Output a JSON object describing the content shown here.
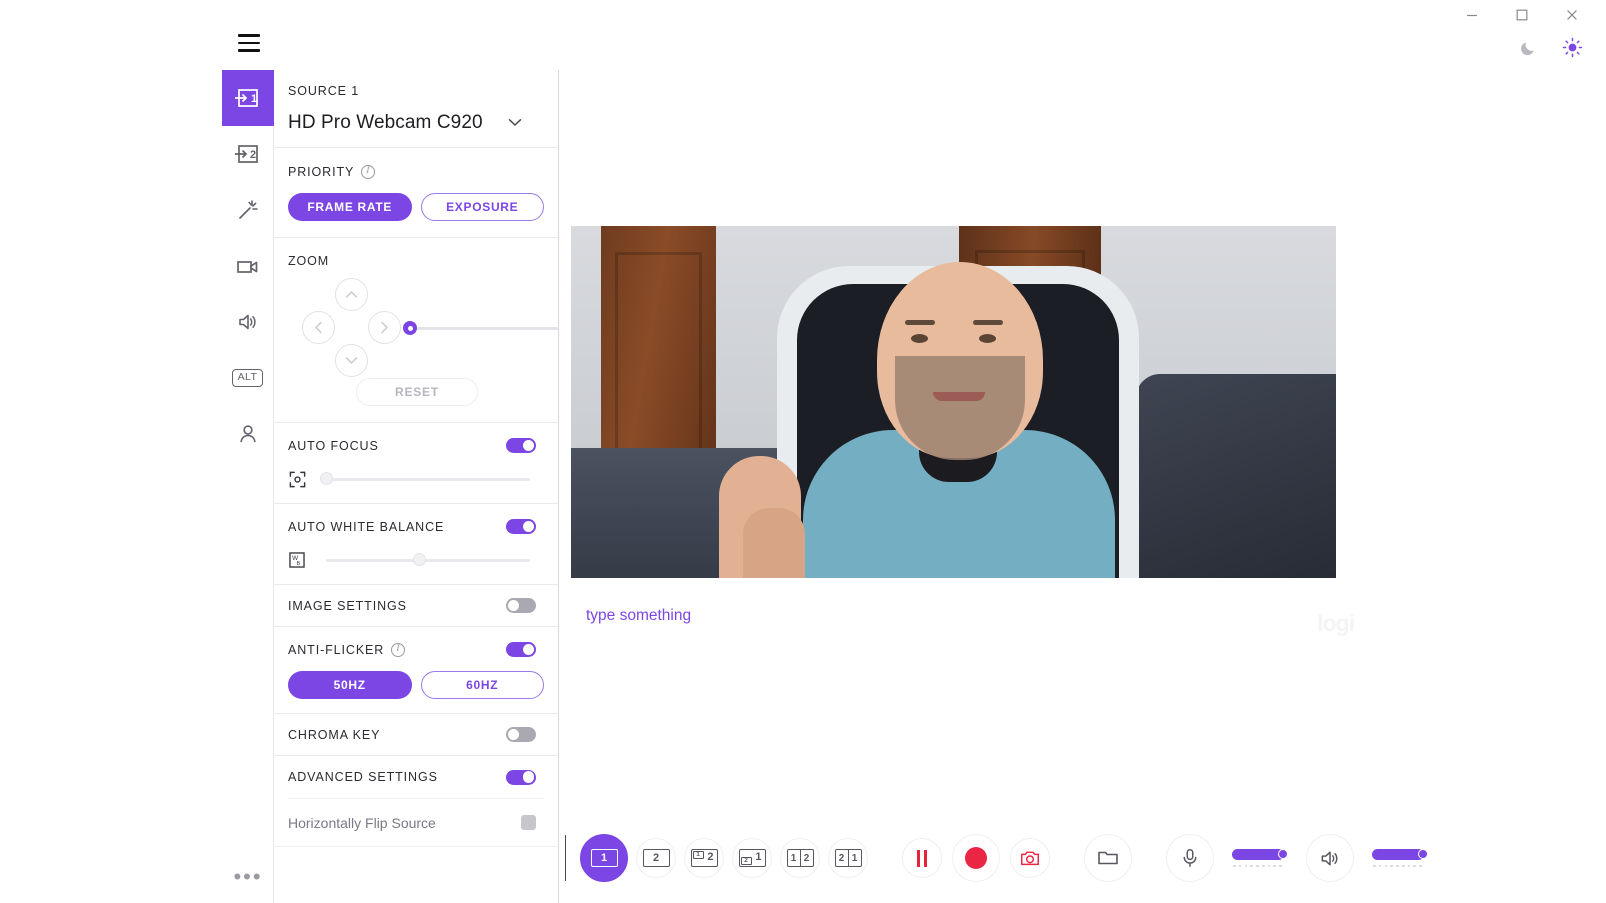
{
  "window": {
    "minimize_label": "Minimize",
    "maximize_label": "Maximize",
    "close_label": "Close",
    "menu_label": "Menu",
    "dark_theme_label": "Dark theme",
    "light_theme_label": "Light theme",
    "active_theme": "light"
  },
  "colors": {
    "accent": "#7B46E3",
    "record_red": "#EB2644",
    "pause_red": "#E5243C",
    "toggle_off": "#a9a9b2",
    "panel_border": "#d8d8dc",
    "muted_text": "#9a9aa2"
  },
  "rail": {
    "items": [
      {
        "name": "source-1",
        "label": "Source 1",
        "icon": "input-1-icon",
        "active": true
      },
      {
        "name": "source-2",
        "label": "Source 2",
        "icon": "input-2-icon",
        "active": false
      },
      {
        "name": "effects",
        "label": "Effects",
        "icon": "magic-wand-icon",
        "active": false
      },
      {
        "name": "video",
        "label": "Video",
        "icon": "video-camera-icon",
        "active": false
      },
      {
        "name": "audio",
        "label": "Audio",
        "icon": "speaker-icon",
        "active": false
      },
      {
        "name": "alt",
        "label": "ALT",
        "icon": "alt-key-icon",
        "active": false
      },
      {
        "name": "account",
        "label": "Account",
        "icon": "person-icon",
        "active": false
      }
    ],
    "more_label": "•••"
  },
  "panel": {
    "source": {
      "title": "SOURCE 1",
      "device": "HD Pro Webcam C920",
      "dropdown_icon": "chevron-down-icon"
    },
    "priority": {
      "title": "PRIORITY",
      "info_icon": "info-icon",
      "options": [
        {
          "label": "FRAME RATE",
          "selected": true
        },
        {
          "label": "EXPOSURE",
          "selected": false
        }
      ]
    },
    "zoom": {
      "title": "ZOOM",
      "pan_up_icon": "chevron-up-icon",
      "pan_left_icon": "chevron-left-icon",
      "pan_right_icon": "chevron-right-icon",
      "pan_down_icon": "chevron-down-icon",
      "slider_value": 0,
      "reset_label": "RESET"
    },
    "auto_focus": {
      "title": "AUTO FOCUS",
      "enabled": true,
      "icon": "focus-target-icon",
      "slider_value": 0
    },
    "auto_white_balance": {
      "title": "AUTO WHITE BALANCE",
      "enabled": true,
      "icon": "white-balance-icon",
      "slider_value": 45
    },
    "image_settings": {
      "title": "IMAGE SETTINGS",
      "enabled": false
    },
    "anti_flicker": {
      "title": "ANTI-FLICKER",
      "info_icon": "info-icon",
      "enabled": true,
      "options": [
        {
          "label": "50HZ",
          "selected": true
        },
        {
          "label": "60HZ",
          "selected": false
        }
      ]
    },
    "chroma_key": {
      "title": "CHROMA KEY",
      "enabled": false
    },
    "advanced_settings": {
      "title": "ADVANCED SETTINGS",
      "enabled": true,
      "items": [
        {
          "label": "Horizontally Flip Source",
          "checked": false
        }
      ]
    }
  },
  "stage": {
    "caption_placeholder": "type something",
    "watermark": "logi",
    "preview_alt": "Webcam preview"
  },
  "bottombar": {
    "layouts": [
      {
        "name": "layout-single",
        "primary": "1",
        "type": "single",
        "active": true
      },
      {
        "name": "layout-second",
        "primary": "2",
        "type": "single",
        "active": false
      },
      {
        "name": "layout-pip-1-in-2",
        "inset": "1",
        "primary": "2",
        "type": "pip-tl",
        "active": false
      },
      {
        "name": "layout-pip-2-in-1",
        "inset": "2",
        "primary": "1",
        "type": "pip-tl",
        "active": false
      },
      {
        "name": "layout-split-1-2",
        "left": "1",
        "right": "2",
        "type": "split",
        "active": false
      },
      {
        "name": "layout-split-2-1",
        "left": "2",
        "right": "1",
        "type": "split",
        "active": false
      }
    ],
    "pause_label": "Pause",
    "record_label": "Record",
    "snapshot_label": "Snapshot",
    "folder_label": "Open folder",
    "mic": {
      "label": "Microphone",
      "icon": "microphone-icon",
      "volume": 100
    },
    "speaker": {
      "label": "Speaker",
      "icon": "speaker-icon",
      "volume": 100
    }
  }
}
